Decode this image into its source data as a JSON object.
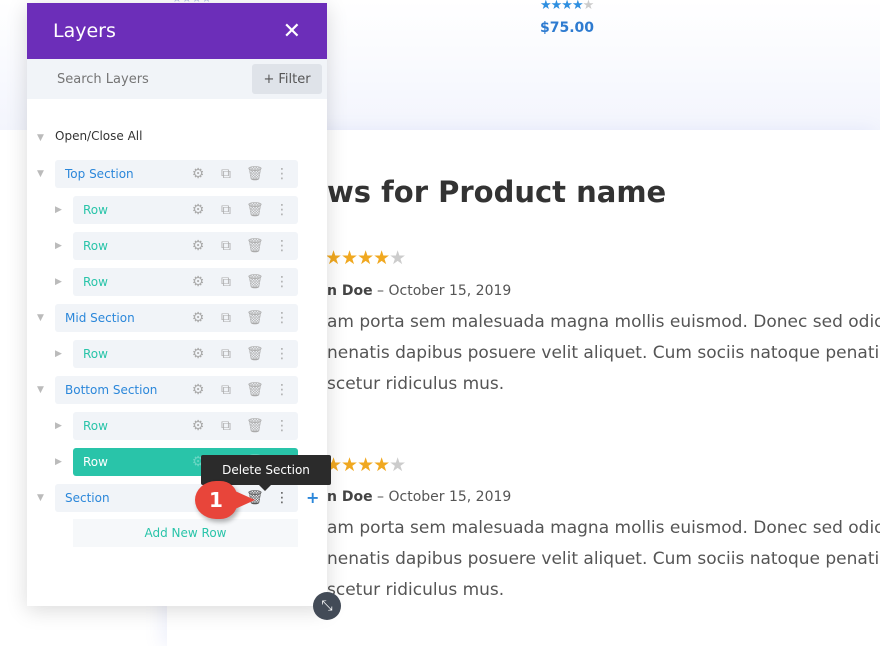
{
  "page": {
    "product_price": "$75.00",
    "product_rating": 4,
    "heading": "ws for Product name",
    "reviews": [
      {
        "rating": 4,
        "author": "n Doe",
        "date": "– October 15, 2019",
        "lines": [
          "am porta sem malesuada magna mollis euismod. Donec sed odio",
          "nenatis dapibus posuere velit aliquet. Cum sociis natoque penatibu",
          "scetur ridiculus mus."
        ]
      },
      {
        "rating": 4,
        "author": "n Doe",
        "date": "– October 15, 2019",
        "lines": [
          "am porta sem malesuada magna mollis euismod. Donec sed odio",
          "nenatis dapibus posuere velit aliquet. Cum sociis natoque penatibu",
          "scetur ridiculus mus."
        ]
      }
    ]
  },
  "layers": {
    "title": "Layers",
    "close_icon": "close-icon",
    "search_placeholder": "Search Layers",
    "filter_label": "Filter",
    "open_close_all": "Open/Close All",
    "items": [
      {
        "label": "Top Section",
        "type": "section"
      },
      {
        "label": "Row",
        "type": "row"
      },
      {
        "label": "Row",
        "type": "row"
      },
      {
        "label": "Row",
        "type": "row"
      },
      {
        "label": "Mid Section",
        "type": "section"
      },
      {
        "label": "Row",
        "type": "row"
      },
      {
        "label": "Bottom Section",
        "type": "section"
      },
      {
        "label": "Row",
        "type": "row"
      },
      {
        "label": "Row",
        "type": "row",
        "active": true
      },
      {
        "label": "Section",
        "type": "section"
      }
    ],
    "add_new_row": "Add New Row",
    "tooltip": "Delete Section",
    "callout_number": "1"
  },
  "colors": {
    "header": "#6c2eb9",
    "section_text": "#2b87da",
    "row_text": "#29c4a9",
    "badge": "#e8453a",
    "stars": "#f0a820"
  }
}
